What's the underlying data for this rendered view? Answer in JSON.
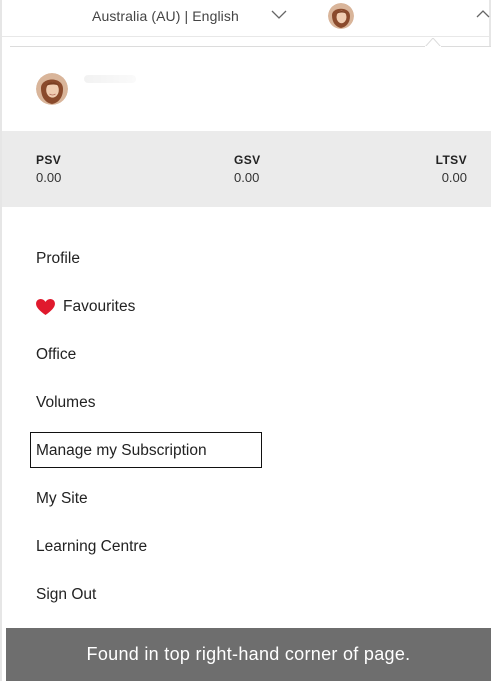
{
  "topbar": {
    "locale_label": "Australia (AU) | English",
    "locale_chevron_icon": "chevron-down-icon",
    "avatar_icon": "user-avatar",
    "collapse_icon": "chevron-up-icon"
  },
  "dropdown": {
    "stats": [
      {
        "label": "PSV",
        "value": "0.00"
      },
      {
        "label": "GSV",
        "value": "0.00"
      },
      {
        "label": "LTSV",
        "value": "0.00"
      }
    ],
    "menu": [
      {
        "label": "Profile"
      },
      {
        "label": "Favourites",
        "icon": "heart-icon"
      },
      {
        "label": "Office"
      },
      {
        "label": "Volumes"
      },
      {
        "label": "Manage my Subscription",
        "highlighted": true
      },
      {
        "label": "My Site"
      },
      {
        "label": "Learning Centre"
      },
      {
        "label": "Sign Out"
      }
    ]
  },
  "caption": {
    "text": "Found in top right-hand corner of page."
  },
  "colors": {
    "stats_bg": "#ebebeb",
    "caption_bg": "#6e6e6e",
    "heart": "#e0192d",
    "text": "#222222"
  }
}
